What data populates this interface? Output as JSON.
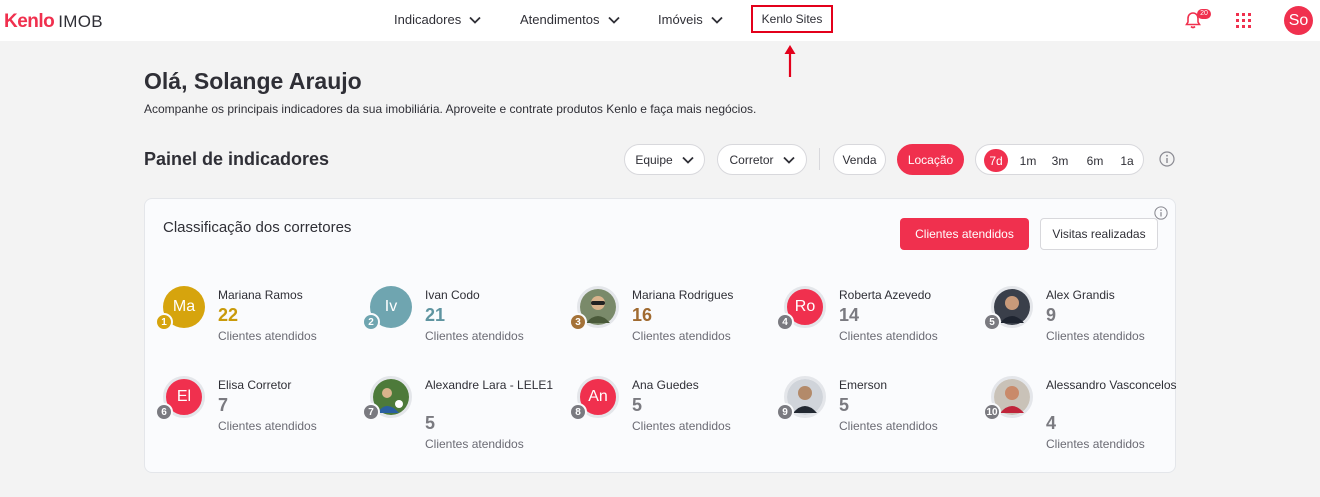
{
  "header": {
    "logo_main": "Kenlo",
    "logo_sub": "IMOB",
    "nav": [
      {
        "label": "Indicadores"
      },
      {
        "label": "Atendimentos"
      },
      {
        "label": "Imóveis"
      }
    ],
    "sites_label": "Kenlo Sites",
    "notification_count": "20",
    "user_initials": "So"
  },
  "greeting": "Olá, Solange Araujo",
  "subtitle": "Acompanhe os principais indicadores da sua imobiliária. Aproveite e contrate produtos Kenlo e faça mais negócios.",
  "panel": {
    "title": "Painel de indicadores",
    "filters": {
      "team": "Equipe",
      "broker": "Corretor"
    },
    "type": {
      "sale": "Venda",
      "rent": "Locação",
      "selected": "Locação"
    },
    "periods": [
      "7d",
      "1m",
      "3m",
      "6m",
      "1a"
    ],
    "selected_period": "7d"
  },
  "ranking": {
    "title": "Classificação dos corretores",
    "tab_clients": "Clientes atendidos",
    "tab_visits": "Visitas realizadas",
    "metric_label": "Clientes atendidos",
    "brokers": [
      {
        "rank": "1",
        "name": "Mariana Ramos",
        "value": "22",
        "initials": "Ma",
        "avatar_color": "#d6a40d",
        "rank_color": "#d6a40d",
        "value_color": "#c99a0a"
      },
      {
        "rank": "2",
        "name": "Ivan Codo",
        "value": "21",
        "initials": "Iv",
        "avatar_color": "#6fa5b0",
        "rank_color": "#6fa5b0",
        "value_color": "#5e94a0"
      },
      {
        "rank": "3",
        "name": "Mariana Rodrigues",
        "value": "16",
        "initials": "",
        "avatar_color": "#7a8a6a",
        "rank_color": "#a47238",
        "value_color": "#a06a30"
      },
      {
        "rank": "4",
        "name": "Roberta Azevedo",
        "value": "14",
        "initials": "Ro",
        "avatar_color": "#f0304e",
        "rank_color": "#7a7a80",
        "value_color": "#7a7a80"
      },
      {
        "rank": "5",
        "name": "Alex Grandis",
        "value": "9",
        "initials": "",
        "avatar_color": "#3a3f4a",
        "rank_color": "#7a7a80",
        "value_color": "#7a7a80"
      },
      {
        "rank": "6",
        "name": "Elisa Corretor",
        "value": "7",
        "initials": "El",
        "avatar_color": "#f0304e",
        "rank_color": "#7a7a80",
        "value_color": "#7a7a80"
      },
      {
        "rank": "7",
        "name": "Alexandre Lara - LELE1",
        "value": "5",
        "initials": "",
        "avatar_color": "#4d7a3a",
        "rank_color": "#7a7a80",
        "value_color": "#7a7a80"
      },
      {
        "rank": "8",
        "name": "Ana Guedes",
        "value": "5",
        "initials": "An",
        "avatar_color": "#f0304e",
        "rank_color": "#7a7a80",
        "value_color": "#7a7a80"
      },
      {
        "rank": "9",
        "name": "Emerson",
        "value": "5",
        "initials": "",
        "avatar_color": "#555a66",
        "rank_color": "#7a7a80",
        "value_color": "#7a7a80"
      },
      {
        "rank": "10",
        "name": "Alessandro Vasconcelos",
        "value": "4",
        "initials": "",
        "avatar_color": "#8a3a3a",
        "rank_color": "#7a7a80",
        "value_color": "#7a7a80"
      }
    ]
  },
  "colors": {
    "accent": "#f0304e",
    "highlight_box": "#e3001b"
  }
}
